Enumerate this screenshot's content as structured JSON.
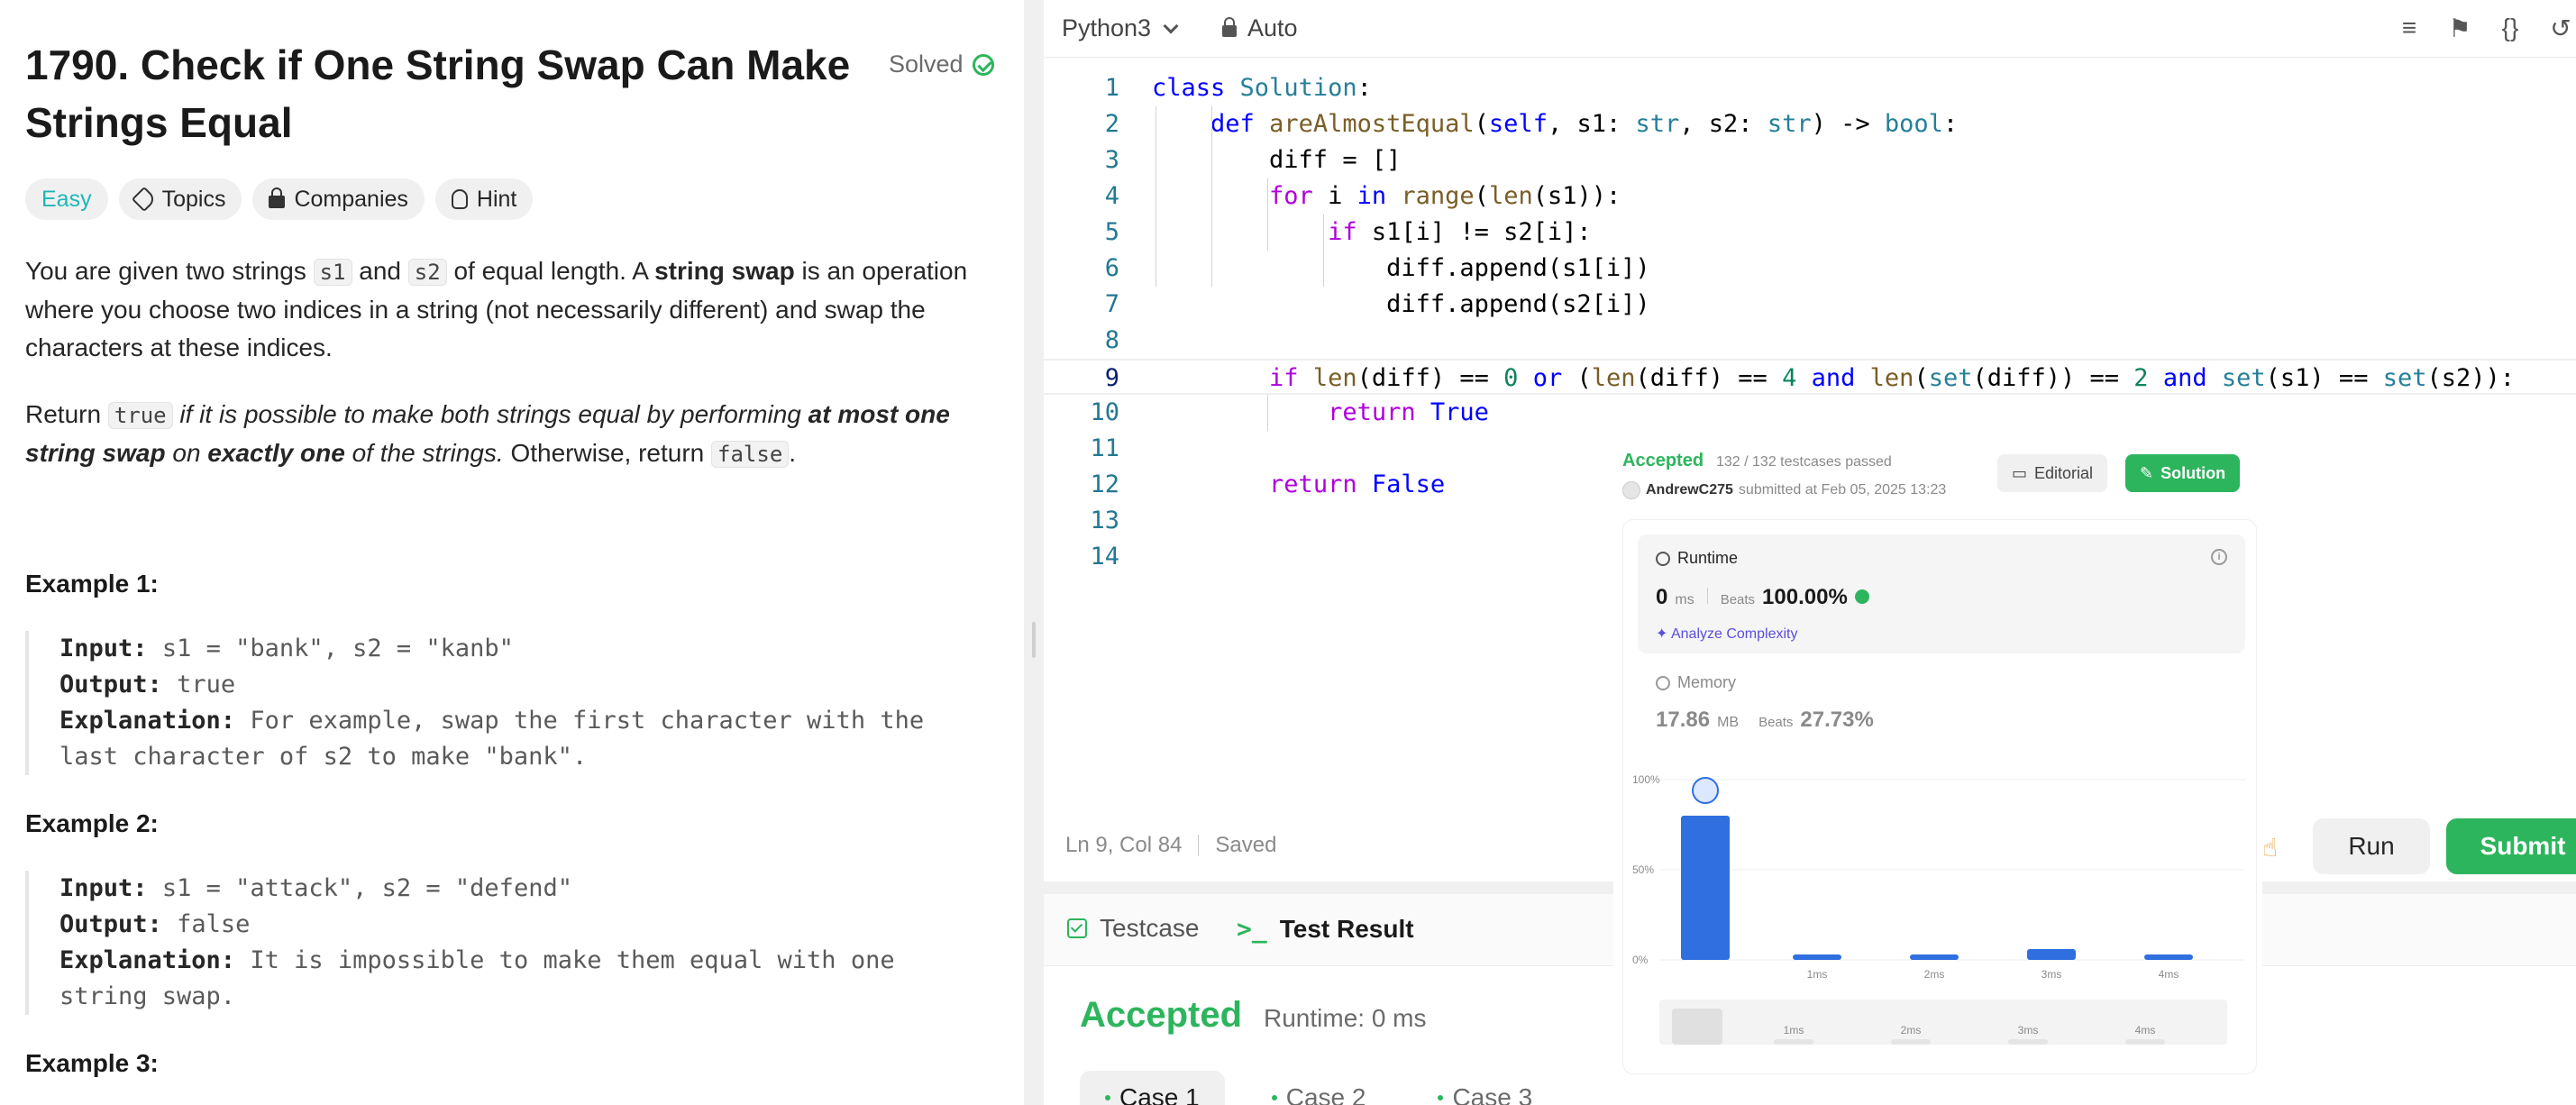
{
  "problem": {
    "title": "1790. Check if One String Swap Can Make Strings Equal",
    "status": "Solved",
    "tags": [
      "Easy",
      "Topics",
      "Companies",
      "Hint"
    ],
    "desc1_a": "You are given two strings ",
    "desc1_s1": "s1",
    "desc1_b": " and ",
    "desc1_s2": "s2",
    "desc1_c": " of equal length. A ",
    "desc1_bold": "string swap",
    "desc1_d": " is an operation where you choose two indices in a string (not necessarily different) and swap the characters at these indices.",
    "desc2_a": "Return ",
    "desc2_true": "true",
    "desc2_i1": " if it is possible to make both strings equal by performing ",
    "desc2_b1": "at most one string swap",
    "desc2_i2": " on ",
    "desc2_b2": "exactly one",
    "desc2_i3": " of the strings.",
    "desc2_c": " Otherwise, return ",
    "desc2_false": "false",
    "desc2_end": ".",
    "examples": [
      {
        "heading": "Example 1:",
        "input": "s1 = \"bank\", s2 = \"kanb\"",
        "output": "true",
        "explanation_1": "For example, swap the first character with the",
        "explanation_2": "last character of s2 to make \"bank\"."
      },
      {
        "heading": "Example 2:",
        "input": "s1 = \"attack\", s2 = \"defend\"",
        "output": "false",
        "explanation_1": "It is impossible to make them equal with one",
        "explanation_2": "string swap."
      },
      {
        "heading": "Example 3:"
      }
    ],
    "labels": {
      "input": "Input:",
      "output": "Output:",
      "explanation": "Explanation:"
    }
  },
  "editor": {
    "language": "Python3",
    "mode": "Auto",
    "line_numbers": [
      "1",
      "2",
      "3",
      "4",
      "5",
      "6",
      "7",
      "8",
      "9",
      "10",
      "11",
      "12",
      "13",
      "14"
    ],
    "status_pos": "Ln 9, Col 84",
    "status_saved": "Saved",
    "run": "Run",
    "submit": "Submit",
    "toolbar_icons": [
      "format-icon",
      "bookmark-icon",
      "braces-icon",
      "undo-icon"
    ]
  },
  "bottom": {
    "tab_testcase": "Testcase",
    "tab_result": "Test Result",
    "result": "Accepted",
    "runtime": "Runtime: 0 ms",
    "cases": [
      "Case 1",
      "Case 2",
      "Case 3"
    ]
  },
  "submission": {
    "status": "Accepted",
    "passed": "132 / 132 testcases passed",
    "user": "AndrewC275",
    "submitted": "submitted at Feb 05, 2025 13:23",
    "editorial": "Editorial",
    "solution": "Solution",
    "runtime_label": "Runtime",
    "runtime_value": "0",
    "runtime_unit": "ms",
    "beats_label": "Beats",
    "runtime_beats": "100.00%",
    "analyze": "Analyze Complexity",
    "memory_label": "Memory",
    "memory_value": "17.86",
    "memory_unit": "MB",
    "memory_beats": "27.73%"
  },
  "chart_data": {
    "type": "bar",
    "categories": [
      "",
      "1ms",
      "2ms",
      "3ms",
      "4ms"
    ],
    "values": [
      80,
      3,
      3,
      6,
      3
    ],
    "ylim": [
      0,
      100
    ],
    "ytick_labels": [
      "100%",
      "50%",
      "0%"
    ],
    "xtick_labels": [
      "1ms",
      "2ms",
      "3ms",
      "4ms"
    ],
    "highlighted_index": 0,
    "colors": {
      "bar": "#2f6fe0",
      "highlight": "#2f6fe0"
    }
  },
  "colors": {
    "accent_green": "#2db55d",
    "easy": "#1cb8b8"
  }
}
